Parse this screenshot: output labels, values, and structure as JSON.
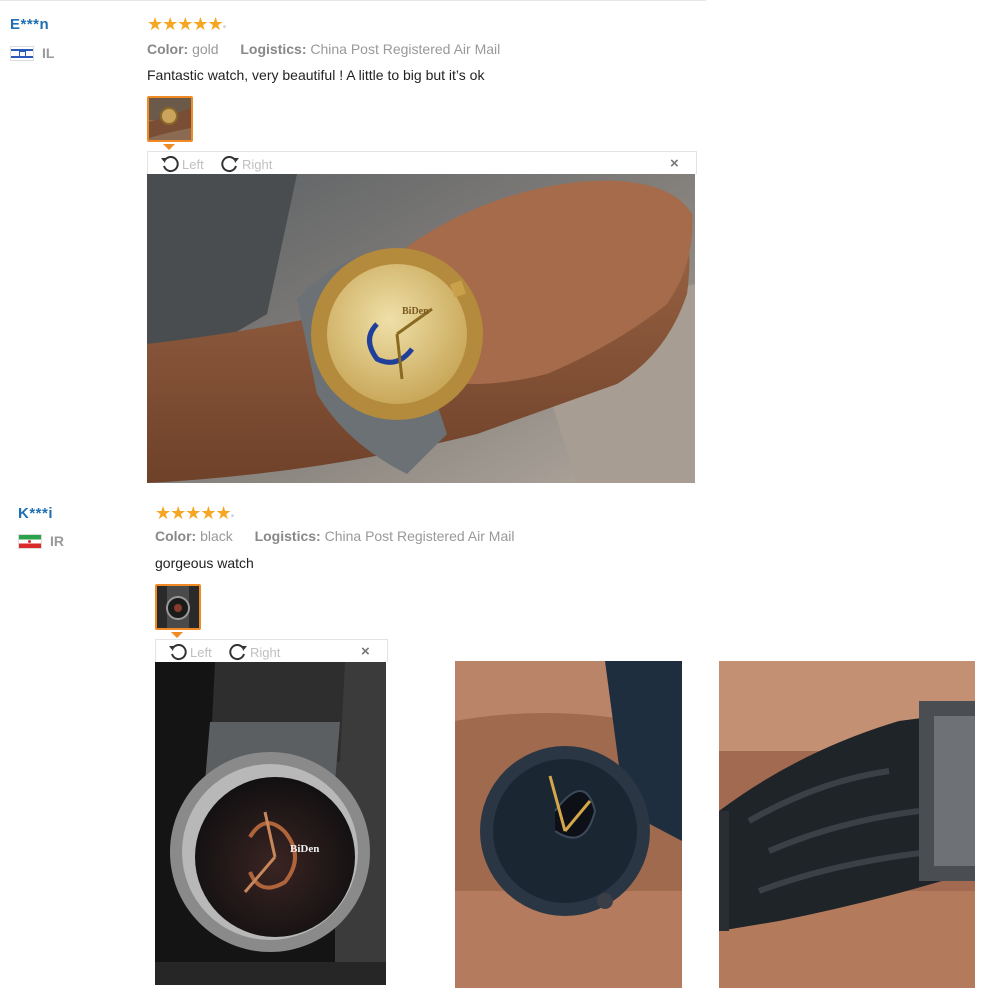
{
  "reviews": [
    {
      "name": "E***n",
      "country": "IL",
      "rating": 5,
      "stars_glyph": "★★★★★",
      "color_label": "Color:",
      "color_value": "gold",
      "logistics_label": "Logistics:",
      "logistics_value": "China Post Registered Air Mail",
      "text": "Fantastic watch, very beautiful ! A little to big but it’s ok",
      "viewer": {
        "left_label": "Left",
        "right_label": "Right",
        "close_label": "×"
      },
      "watch_brand": "BiDen"
    },
    {
      "name": "K***i",
      "country": "IR",
      "rating": 5,
      "stars_glyph": "★★★★★",
      "color_label": "Color:",
      "color_value": "black",
      "logistics_label": "Logistics:",
      "logistics_value": "China Post Registered Air Mail",
      "text": "gorgeous watch",
      "viewer": {
        "left_label": "Left",
        "right_label": "Right",
        "close_label": "×"
      },
      "watch_brand": "BiDen"
    }
  ],
  "icons": {
    "rotate_left": "rotate-left-icon",
    "rotate_right": "rotate-right-icon",
    "close": "close-icon",
    "star": "star-icon"
  },
  "colors": {
    "name_blue": "#1f6fb2",
    "star_orange": "#f5a623",
    "thumb_border": "#f08a24",
    "muted_gray": "#999999"
  }
}
